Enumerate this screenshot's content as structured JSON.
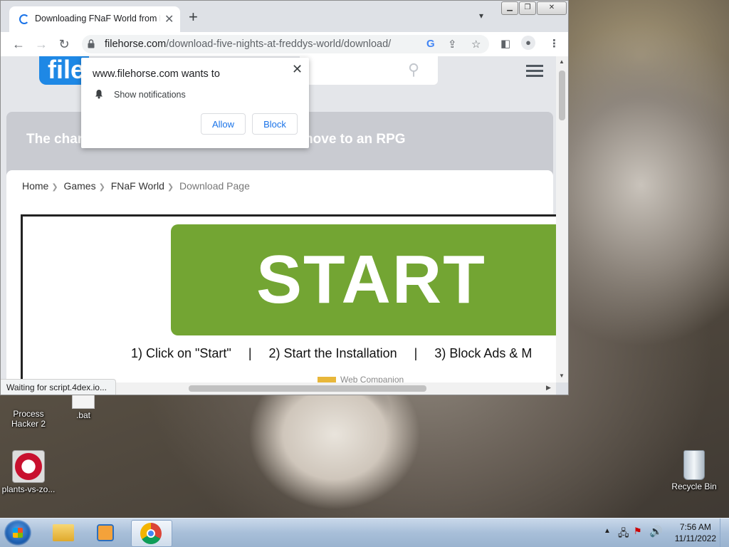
{
  "browser": {
    "tab_title": "Downloading FNaF World from F",
    "url_domain": "filehorse.com",
    "url_path": "/download-five-nights-at-freddys-world/download/",
    "status_text": "Waiting for script.4dex.io..."
  },
  "notification_prompt": {
    "title": "www.filehorse.com wants to",
    "permission": "Show notifications",
    "allow_label": "Allow",
    "block_label": "Block"
  },
  "page": {
    "logo_text": "file",
    "banner_left": "The char",
    "banner_right": "move to an RPG",
    "breadcrumb": [
      "Home",
      "Games",
      "FNaF World",
      "Download Page"
    ],
    "ad": {
      "start_label": "START",
      "step1": "1) Click on \"Start\"",
      "step2": "2) Start the Installation",
      "step3": "3) Block Ads & M",
      "sep": "|",
      "footer": "Web Companion"
    }
  },
  "desktop": {
    "icons": [
      {
        "label_line1": "Process",
        "label_line2": "Hacker 2"
      },
      {
        "label_line1": ".bat",
        "label_line2": ""
      },
      {
        "label_line1": "plants-vs-zo...",
        "label_line2": ""
      },
      {
        "label_line1": "Recycle Bin",
        "label_line2": ""
      }
    ]
  },
  "taskbar": {
    "time": "7:56 AM",
    "date": "11/11/2022"
  },
  "colors": {
    "start_green": "#73a533",
    "chrome_blue": "#1a73e8",
    "logo_blue": "#1e88e5"
  }
}
